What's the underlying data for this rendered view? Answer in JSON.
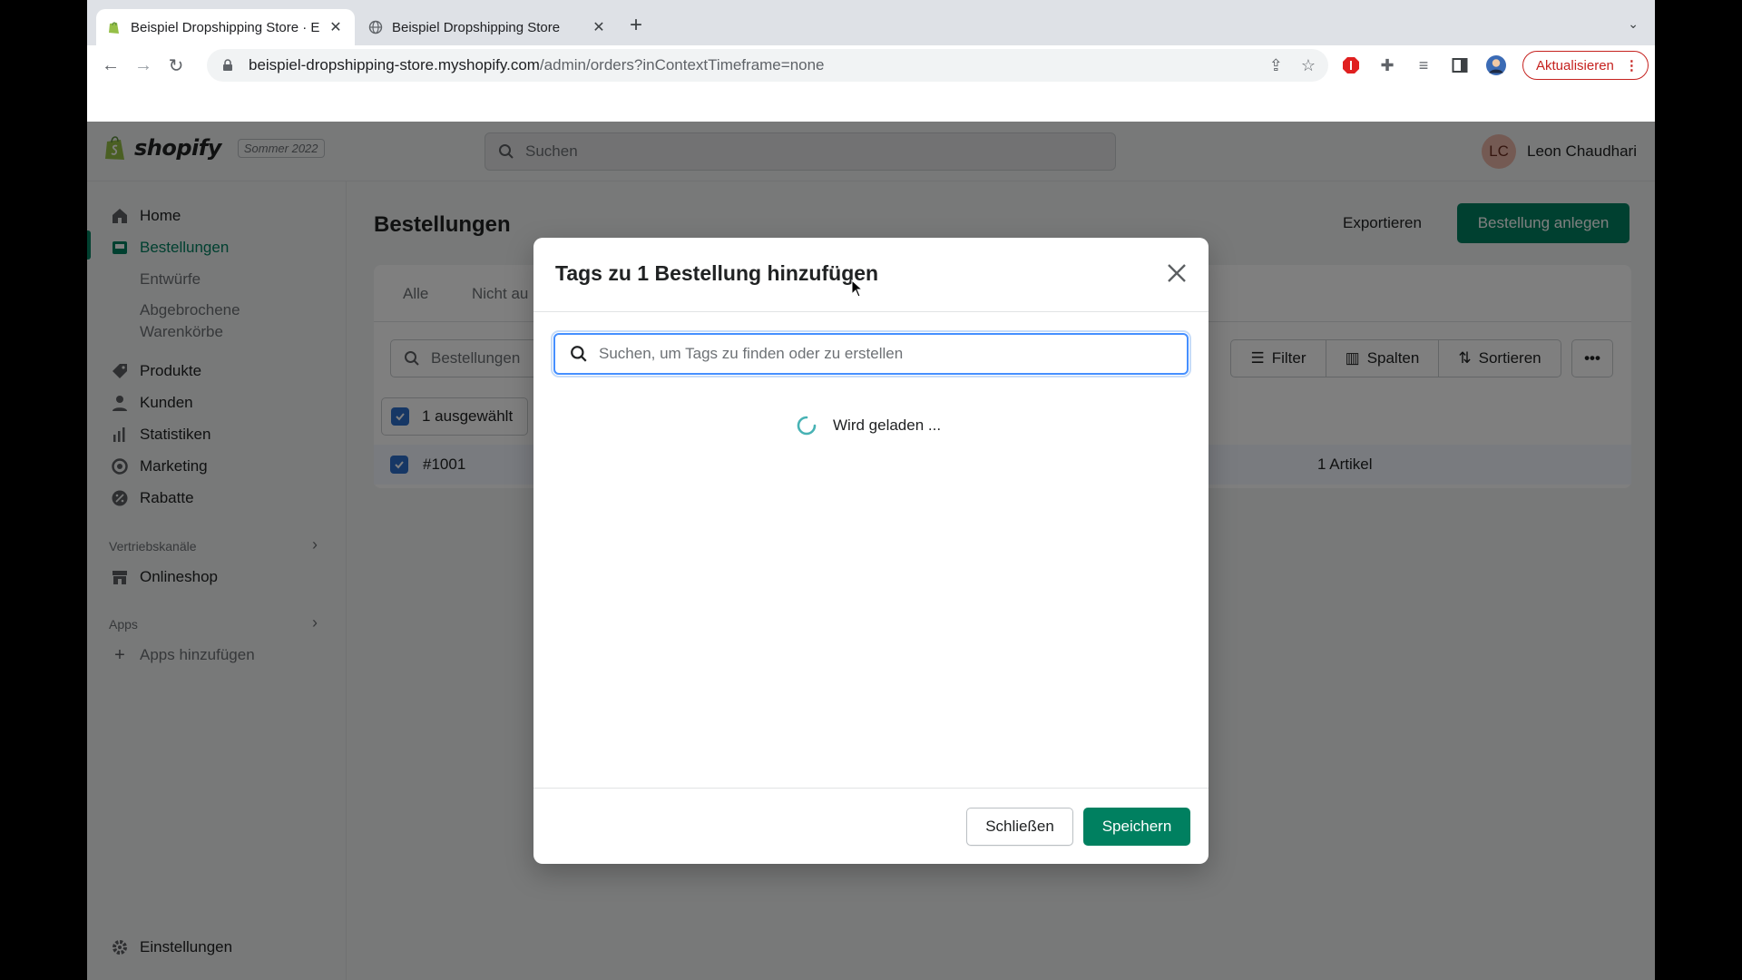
{
  "browser": {
    "tabs": [
      {
        "title": "Beispiel Dropshipping Store · E",
        "active": true
      },
      {
        "title": "Beispiel Dropshipping Store",
        "active": false
      }
    ],
    "url_host": "beispiel-dropshipping-store.myshopify.com",
    "url_path": "/admin/orders?inContextTimeframe=none",
    "update_label": "Aktualisieren"
  },
  "topbar": {
    "brand": "shopify",
    "edition_badge": "Sommer 2022",
    "search_placeholder": "Suchen",
    "user_initials": "LC",
    "user_name": "Leon Chaudhari"
  },
  "sidebar": {
    "items": [
      {
        "label": "Home",
        "icon": "home-icon"
      },
      {
        "label": "Bestellungen",
        "icon": "orders-icon",
        "selected": true
      },
      {
        "label": "Entwürfe"
      },
      {
        "label": "Abgebrochene Warenkörbe"
      },
      {
        "label": "Produkte",
        "icon": "tag-icon"
      },
      {
        "label": "Kunden",
        "icon": "person-icon"
      },
      {
        "label": "Statistiken",
        "icon": "bar-chart-icon"
      },
      {
        "label": "Marketing",
        "icon": "target-icon"
      },
      {
        "label": "Rabatte",
        "icon": "discount-icon"
      }
    ],
    "sales_channels_label": "Vertriebskanäle",
    "online_store_label": "Onlineshop",
    "apps_label": "Apps",
    "add_apps_label": "Apps hinzufügen",
    "settings_label": "Einstellungen"
  },
  "page": {
    "title": "Bestellungen",
    "export_label": "Exportieren",
    "create_label": "Bestellung anlegen",
    "tabs": [
      "Alle",
      "Nicht au"
    ],
    "search_placeholder": "Bestellungen",
    "filter_label": "Filter",
    "columns_label": "Spalten",
    "sort_label": "Sortieren",
    "selected_label": "1 ausgewählt",
    "order_number": "#1001",
    "order_items": "1 Artikel"
  },
  "modal": {
    "title": "Tags zu 1 Bestellung hinzufügen",
    "search_placeholder": "Suchen, um Tags zu finden oder zu erstellen",
    "loading_text": "Wird geladen ...",
    "close_label": "Schließen",
    "save_label": "Speichern"
  },
  "colors": {
    "accent": "#008060",
    "focus": "#458fff",
    "checkbox": "#2c6ecb"
  }
}
